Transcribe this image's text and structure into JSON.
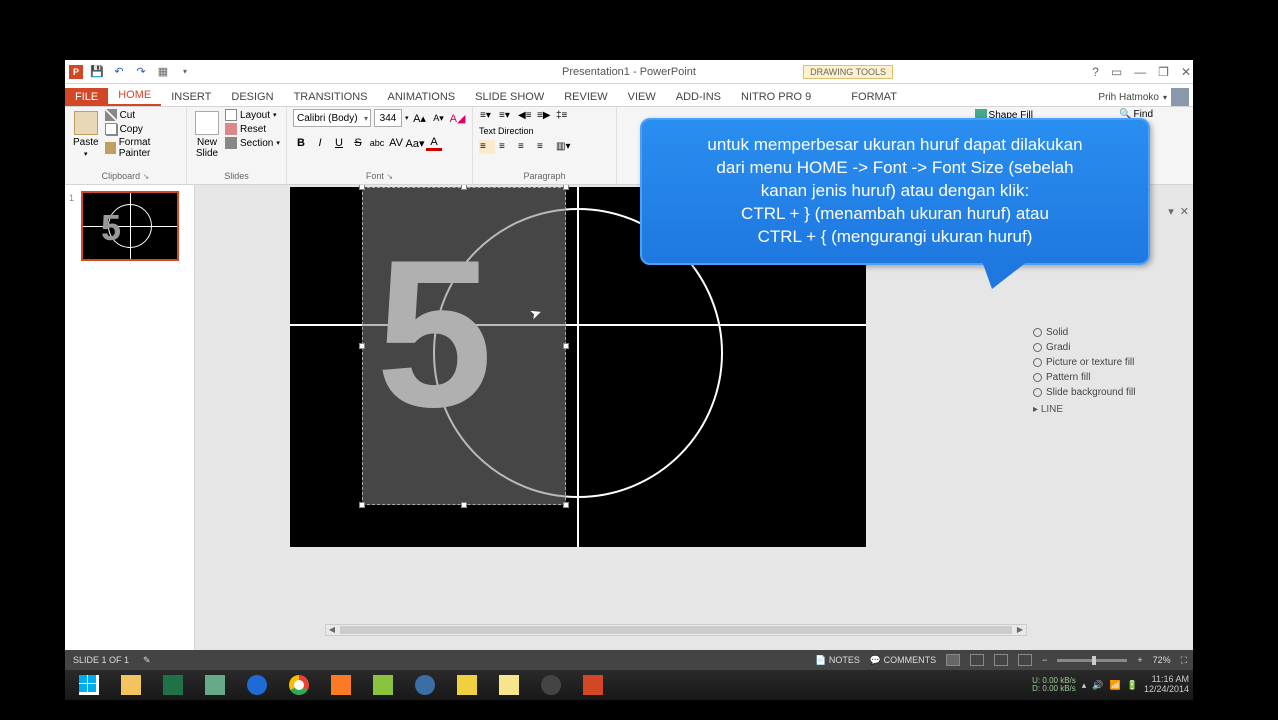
{
  "titlebar": {
    "title": "Presentation1 - PowerPoint",
    "context_label": "DRAWING TOOLS"
  },
  "win_controls": {
    "help": "?",
    "ribbon_opts": "▭",
    "min": "—",
    "restore": "❐",
    "close": "✕"
  },
  "tabs": {
    "file": "FILE",
    "home": "HOME",
    "insert": "INSERT",
    "design": "DESIGN",
    "transitions": "TRANSITIONS",
    "animations": "ANIMATIONS",
    "slideshow": "SLIDE SHOW",
    "review": "REVIEW",
    "view": "VIEW",
    "addins": "ADD-INS",
    "nitro": "NITRO PRO 9",
    "format": "FORMAT"
  },
  "user": {
    "name": "Prih Hatmoko"
  },
  "ribbon": {
    "clipboard": {
      "label": "Clipboard",
      "paste": "Paste",
      "cut": "Cut",
      "copy": "Copy",
      "format_painter": "Format Painter"
    },
    "slides": {
      "label": "Slides",
      "new_slide": "New\nSlide",
      "layout": "Layout",
      "reset": "Reset",
      "section": "Section"
    },
    "font": {
      "label": "Font",
      "name": "Calibri (Body)",
      "size": "344"
    },
    "paragraph": {
      "label": "Paragraph",
      "text_direction": "Text Direction"
    },
    "drawing": {
      "shape_fill": "Shape Fill"
    },
    "editing": {
      "find": "Find"
    }
  },
  "thumb": {
    "num": "1",
    "digit": "5"
  },
  "slide": {
    "digit": "5"
  },
  "format_pane": {
    "solid": "Solid",
    "gradient": "Gradi",
    "picture": "Picture or texture fill",
    "pattern": "Pattern fill",
    "slidebg": "Slide background fill",
    "line": "LINE"
  },
  "status": {
    "slide": "SLIDE 1 OF 1",
    "notes": "NOTES",
    "comments": "COMMENTS",
    "zoom": "72%"
  },
  "callout": {
    "l1": "untuk memperbesar ukuran huruf dapat dilakukan",
    "l2": "dari menu HOME -> Font -> Font Size (sebelah",
    "l3": "kanan jenis huruf) atau  dengan klik:",
    "l4": "CTRL + } (menambah ukuran huruf) atau",
    "l5": "CTRL + { (mengurangi ukuran huruf)"
  },
  "tray": {
    "net_u": "U:",
    "net_d": "D:",
    "net_us": "0.00 kB/s",
    "net_ds": "0.00 kB/s",
    "time": "11:16 AM",
    "date": "12/24/2014"
  }
}
